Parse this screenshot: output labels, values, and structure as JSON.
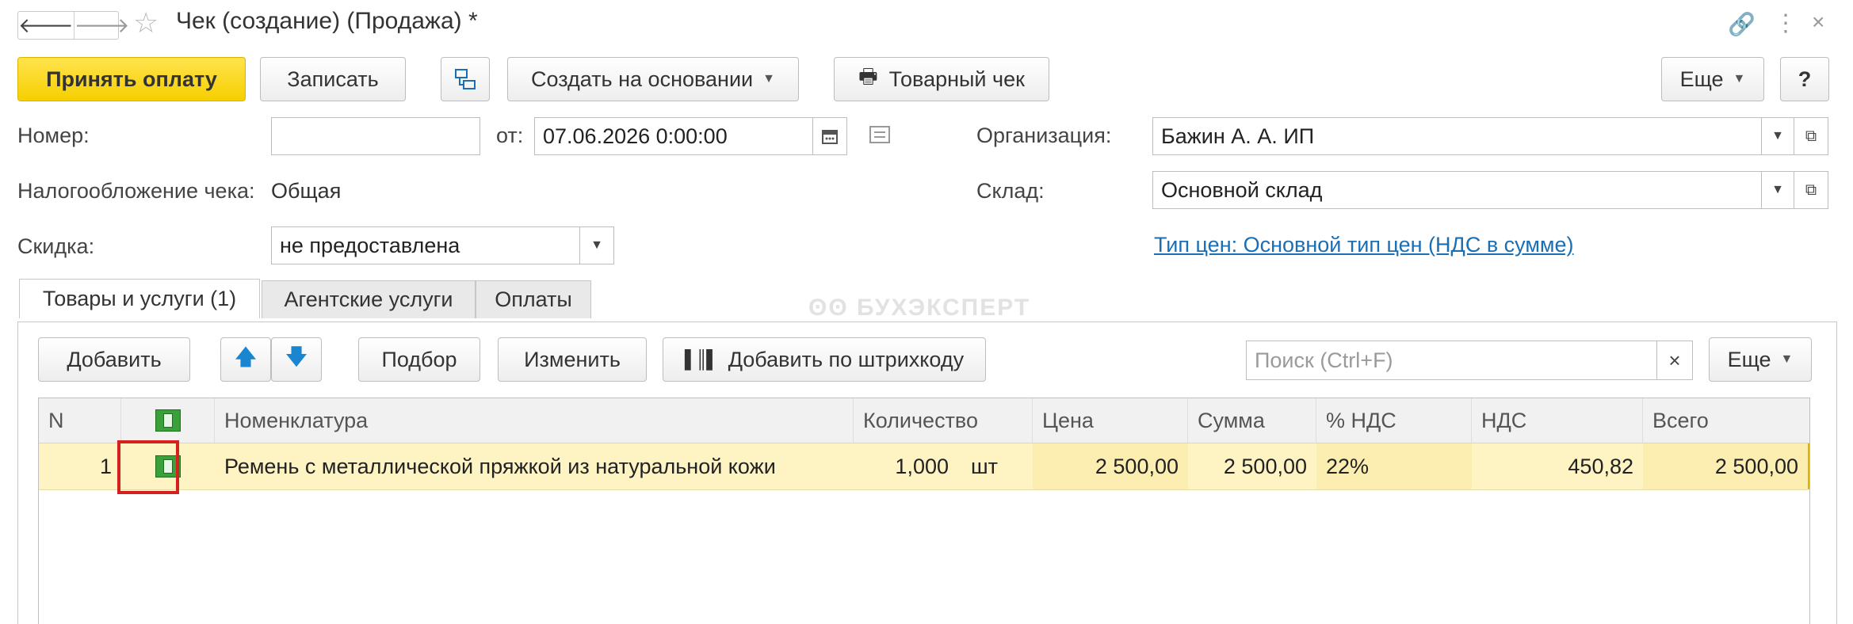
{
  "window": {
    "title": "Чек (создание) (Продажа) *",
    "nav_back": "🡐",
    "nav_forward": "🡒"
  },
  "toolbar": {
    "accept_payment": "Принять оплату",
    "save": "Записать",
    "create_based_on": "Создать на основании",
    "goods_receipt": "Товарный чек",
    "more": "Еще",
    "help": "?"
  },
  "form": {
    "number_label": "Номер:",
    "number_value": "",
    "date_label": "от:",
    "date_value": "07.06.2026  0:00:00",
    "organization_label": "Организация:",
    "organization_value": "Бажин А. А. ИП",
    "taxation_label": "Налогообложение чека:",
    "taxation_value": "Общая",
    "warehouse_label": "Склад:",
    "warehouse_value": "Основной склад",
    "discount_label": "Скидка:",
    "discount_value": "не предоставлена",
    "price_type_link": "Тип цен: Основной тип цен (НДС в сумме)"
  },
  "tabs": [
    {
      "label": "Товары и услуги (1)",
      "active": true
    },
    {
      "label": "Агентские услуги",
      "active": false
    },
    {
      "label": "Оплаты",
      "active": false
    }
  ],
  "watermark": "БУХЭКСПЕРТ",
  "table_toolbar": {
    "add": "Добавить",
    "pick": "Подбор",
    "edit": "Изменить",
    "add_by_barcode": "Добавить по штрихкоду",
    "search_placeholder": "Поиск (Ctrl+F)",
    "more": "Еще"
  },
  "table": {
    "columns": {
      "n": "N",
      "nomenclature": "Номенклатура",
      "quantity": "Количество",
      "price": "Цена",
      "sum": "Сумма",
      "vat_rate": "% НДС",
      "vat": "НДС",
      "total": "Всего"
    },
    "rows": [
      {
        "n": "1",
        "nomenclature": "Ремень с металлической пряжкой из натуральной кожи",
        "quantity": "1,000",
        "unit": "шт",
        "price": "2 500,00",
        "sum": "2 500,00",
        "vat_rate": "22%",
        "vat": "450,82",
        "total": "2 500,00"
      }
    ]
  },
  "colors": {
    "primary_button": "#f6cf00",
    "selected_row": "#fdf3c3",
    "link": "#1a6fb4",
    "highlight_box": "#d62020"
  }
}
